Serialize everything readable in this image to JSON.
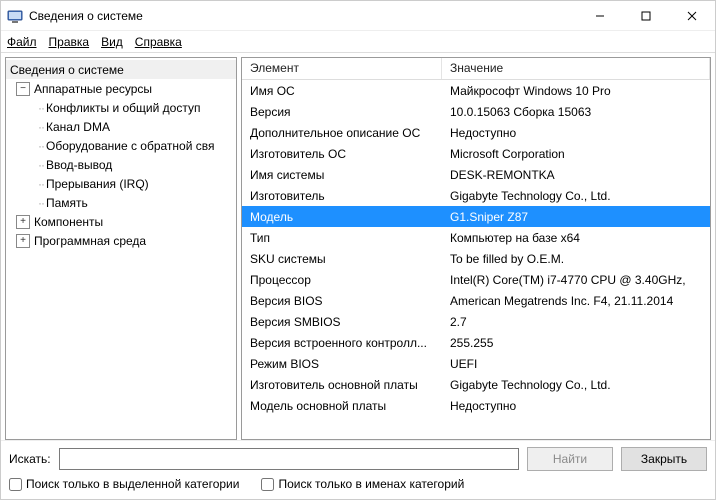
{
  "window": {
    "title": "Сведения о системе"
  },
  "menu": {
    "file": "Файл",
    "edit": "Правка",
    "view": "Вид",
    "help": "Справка"
  },
  "tree": {
    "root": "Сведения о системе",
    "hw": "Аппаратные ресурсы",
    "hw_children": [
      "Конфликты и общий доступ",
      "Канал DMA",
      "Оборудование с обратной свя",
      "Ввод-вывод",
      "Прерывания (IRQ)",
      "Память"
    ],
    "components": "Компоненты",
    "softenv": "Программная среда"
  },
  "grid": {
    "col_elem": "Элемент",
    "col_val": "Значение",
    "rows": [
      {
        "elem": "Имя ОС",
        "val": "Майкрософт Windows 10 Pro"
      },
      {
        "elem": "Версия",
        "val": "10.0.15063 Сборка 15063"
      },
      {
        "elem": "Дополнительное описание ОС",
        "val": "Недоступно"
      },
      {
        "elem": "Изготовитель ОС",
        "val": "Microsoft Corporation"
      },
      {
        "elem": "Имя системы",
        "val": "DESK-REMONTKA"
      },
      {
        "elem": "Изготовитель",
        "val": "Gigabyte Technology Co., Ltd."
      },
      {
        "elem": "Модель",
        "val": "G1.Sniper Z87",
        "selected": true
      },
      {
        "elem": "Тип",
        "val": "Компьютер на базе x64"
      },
      {
        "elem": "SKU системы",
        "val": "To be filled by O.E.M."
      },
      {
        "elem": "Процессор",
        "val": "Intel(R) Core(TM) i7-4770 CPU @ 3.40GHz,"
      },
      {
        "elem": "Версия BIOS",
        "val": "American Megatrends Inc. F4, 21.11.2014"
      },
      {
        "elem": "Версия SMBIOS",
        "val": "2.7"
      },
      {
        "elem": "Версия встроенного контролл...",
        "val": "255.255"
      },
      {
        "elem": "Режим BIOS",
        "val": "UEFI"
      },
      {
        "elem": "Изготовитель основной платы",
        "val": "Gigabyte Technology Co., Ltd."
      },
      {
        "elem": "Модель основной платы",
        "val": "Недоступно"
      }
    ]
  },
  "bottom": {
    "search_label": "Искать:",
    "find_btn": "Найти",
    "close_btn": "Закрыть",
    "chk_sel_cat": "Поиск только в выделенной категории",
    "chk_names_only": "Поиск только в именах категорий",
    "search_value": ""
  }
}
